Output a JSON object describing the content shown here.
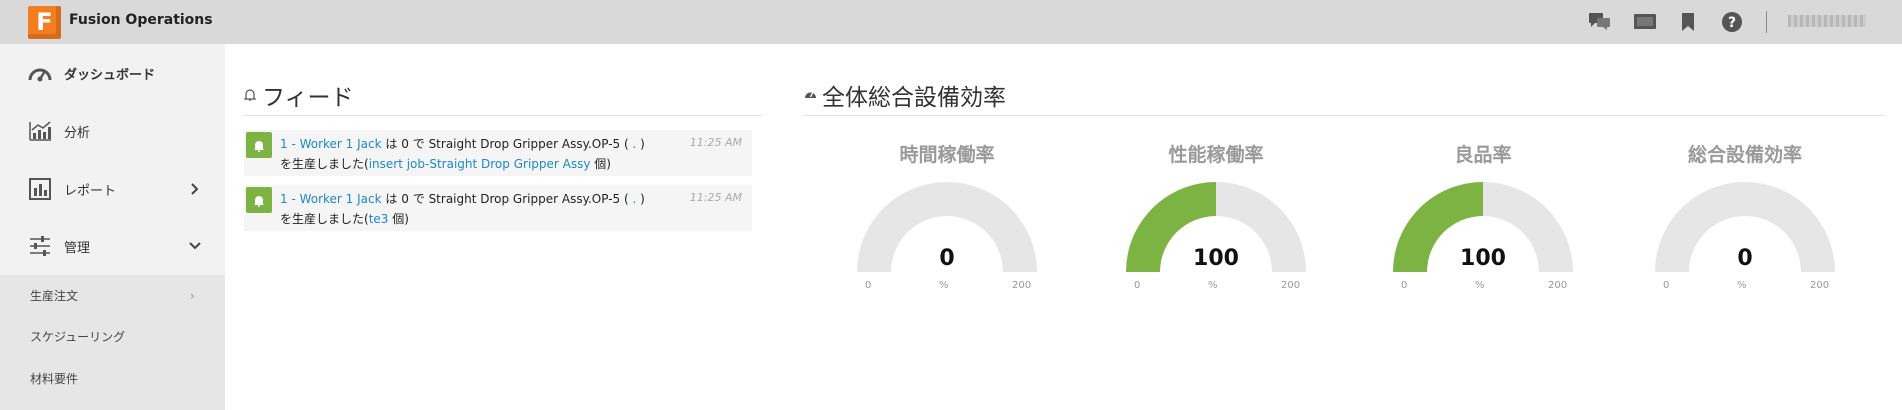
{
  "app": {
    "title": "Fusion Operations",
    "logo_letter": "F",
    "user_name": "user"
  },
  "topbar_icons": [
    "chat-icon",
    "monitor-icon",
    "bookmark-icon",
    "help-icon"
  ],
  "sidebar": {
    "items": [
      {
        "label": "ダッシュボード",
        "icon": "dashboard-gauge-icon"
      },
      {
        "label": "分析",
        "icon": "analytics-chart-icon"
      },
      {
        "label": "レポート",
        "icon": "report-bar-icon"
      },
      {
        "label": "管理",
        "icon": "settings-sliders-icon"
      }
    ],
    "sub_items": [
      {
        "label": "生産注文"
      },
      {
        "label": "スケジューリング"
      },
      {
        "label": "材料要件"
      }
    ]
  },
  "feed": {
    "title": "フィード",
    "items": [
      {
        "worker": "1 - Worker 1 Jack",
        "ha": "は",
        "qty": "0",
        "de": "で",
        "product": "Straight Drop Gripper Assy.OP-5 (",
        "dot": ".",
        "paren_close": ")",
        "produced": "を生産しました(",
        "job": "insert job-Straight Drop Gripper Assy",
        "unit": "個)",
        "time": "11:25 AM"
      },
      {
        "worker": "1 - Worker 1 Jack",
        "ha": "は",
        "qty": "0",
        "de": "で",
        "product": "Straight Drop Gripper Assy.OP-5 (",
        "dot": ".",
        "paren_close": ")",
        "produced": "を生産しました(",
        "job": "te3",
        "unit": "個)",
        "time": "11:25 AM"
      }
    ]
  },
  "oee": {
    "title": "全体総合設備効率",
    "fill_color": "#7cb342",
    "track_color": "#e6e6e6",
    "gauges": [
      {
        "title": "時間稼働率",
        "value": "0",
        "value_num": 0,
        "min": "0",
        "max": "200",
        "unit": "%"
      },
      {
        "title": "性能稼働率",
        "value": "100",
        "value_num": 100,
        "min": "0",
        "max": "200",
        "unit": "%"
      },
      {
        "title": "良品率",
        "value": "100",
        "value_num": 100,
        "min": "0",
        "max": "200",
        "unit": "%"
      },
      {
        "title": "総合設備効率",
        "value": "0",
        "value_num": 0,
        "min": "0",
        "max": "200",
        "unit": "%"
      }
    ]
  }
}
